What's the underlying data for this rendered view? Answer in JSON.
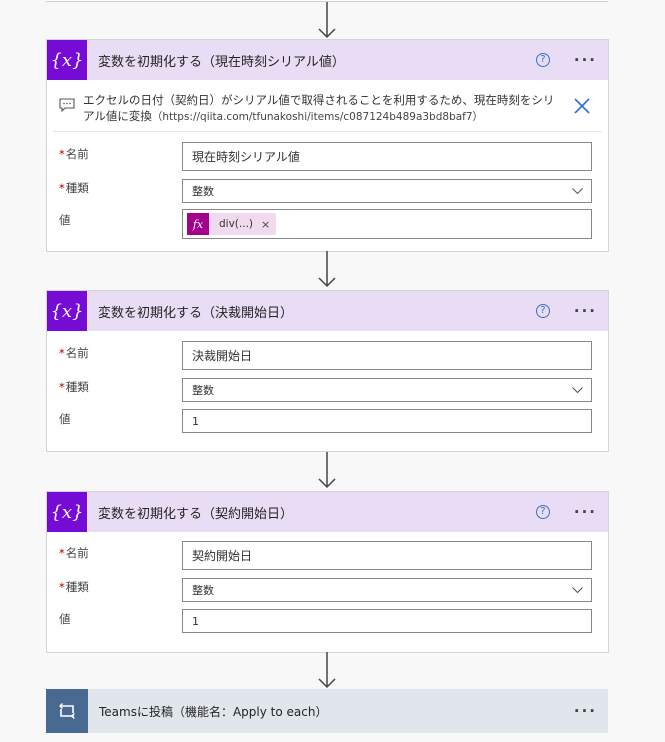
{
  "cards": [
    {
      "title": "変数を初期化する（現在時刻シリアル値）",
      "comment": "エクセルの日付（契約日）がシリアル値で取得されることを利用するため、現在時刻をシリアル値に変換",
      "comment_url": "（https://qiita.com/tfunakoshi/items/c087124b489a3bd8baf7）",
      "fields": {
        "name_label": "名前",
        "name_value": "現在時刻シリアル値",
        "type_label": "種類",
        "type_value": "整数",
        "value_label": "値",
        "value_token": "div(...)"
      }
    },
    {
      "title": "変数を初期化する（決裁開始日）",
      "fields": {
        "name_label": "名前",
        "name_value": "決裁開始日",
        "type_label": "種類",
        "type_value": "整数",
        "value_label": "値",
        "value_value": "1"
      }
    },
    {
      "title": "変数を初期化する（契約開始日）",
      "fields": {
        "name_label": "名前",
        "name_value": "契約開始日",
        "type_label": "種類",
        "type_value": "整数",
        "value_label": "値",
        "value_value": "1"
      }
    }
  ],
  "common": {
    "var_icon": "{x}",
    "help_icon": "?",
    "more_icon": "···",
    "required_mark": "*",
    "fx_icon": "fx",
    "token_remove": "×"
  },
  "teams_card": {
    "title": "Teamsに投稿（機能名：Apply to each）"
  },
  "colors": {
    "variable_accent": "#770bd6",
    "variable_header": "#e9dcf5",
    "expression_token": "#a3008d",
    "loop_accent": "#486991",
    "loop_header": "#e1e6ed"
  }
}
